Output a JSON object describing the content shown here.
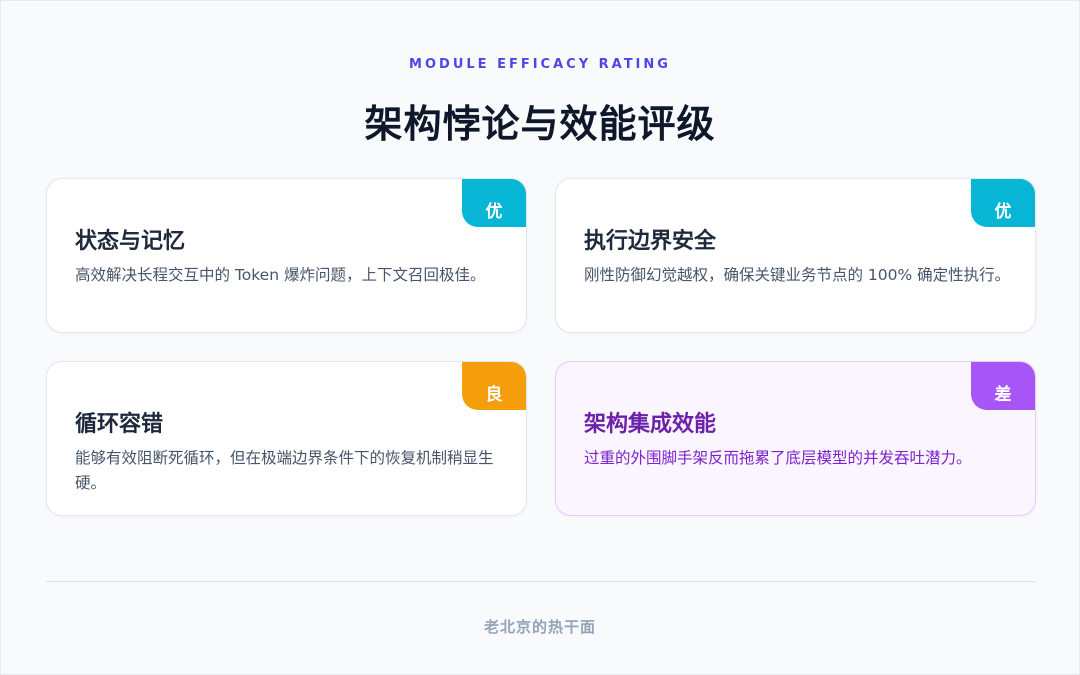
{
  "header": {
    "eyebrow": "MODULE EFFICACY RATING",
    "title": "架构悖论与效能评级"
  },
  "cards": [
    {
      "title": "状态与记忆",
      "desc": "高效解决长程交互中的 Token 爆炸问题，上下文召回极佳。",
      "badge": "优",
      "badge_color": "#06b6d4"
    },
    {
      "title": "执行边界安全",
      "desc": "刚性防御幻觉越权，确保关键业务节点的 100% 确定性执行。",
      "badge": "优",
      "badge_color": "#06b6d4"
    },
    {
      "title": "循环容错",
      "desc": "能够有效阻断死循环，但在极端边界条件下的恢复机制稍显生硬。",
      "badge": "良",
      "badge_color": "#f59e0b"
    },
    {
      "title": "架构集成效能",
      "desc": "过重的外围脚手架反而拖累了底层模型的并发吞吐潜力。",
      "badge": "差",
      "badge_color": "#a855f7"
    }
  ],
  "footer": {
    "text": "老北京的热干面"
  }
}
